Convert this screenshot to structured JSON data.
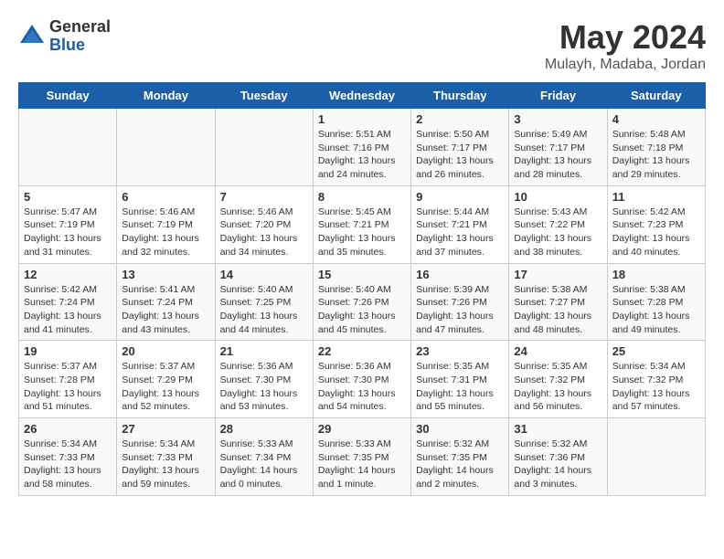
{
  "header": {
    "logo_general": "General",
    "logo_blue": "Blue",
    "title": "May 2024",
    "subtitle": "Mulayh, Madaba, Jordan"
  },
  "days_of_week": [
    "Sunday",
    "Monday",
    "Tuesday",
    "Wednesday",
    "Thursday",
    "Friday",
    "Saturday"
  ],
  "weeks": [
    [
      {
        "day": "",
        "info": ""
      },
      {
        "day": "",
        "info": ""
      },
      {
        "day": "",
        "info": ""
      },
      {
        "day": "1",
        "info": "Sunrise: 5:51 AM\nSunset: 7:16 PM\nDaylight: 13 hours\nand 24 minutes."
      },
      {
        "day": "2",
        "info": "Sunrise: 5:50 AM\nSunset: 7:17 PM\nDaylight: 13 hours\nand 26 minutes."
      },
      {
        "day": "3",
        "info": "Sunrise: 5:49 AM\nSunset: 7:17 PM\nDaylight: 13 hours\nand 28 minutes."
      },
      {
        "day": "4",
        "info": "Sunrise: 5:48 AM\nSunset: 7:18 PM\nDaylight: 13 hours\nand 29 minutes."
      }
    ],
    [
      {
        "day": "5",
        "info": "Sunrise: 5:47 AM\nSunset: 7:19 PM\nDaylight: 13 hours\nand 31 minutes."
      },
      {
        "day": "6",
        "info": "Sunrise: 5:46 AM\nSunset: 7:19 PM\nDaylight: 13 hours\nand 32 minutes."
      },
      {
        "day": "7",
        "info": "Sunrise: 5:46 AM\nSunset: 7:20 PM\nDaylight: 13 hours\nand 34 minutes."
      },
      {
        "day": "8",
        "info": "Sunrise: 5:45 AM\nSunset: 7:21 PM\nDaylight: 13 hours\nand 35 minutes."
      },
      {
        "day": "9",
        "info": "Sunrise: 5:44 AM\nSunset: 7:21 PM\nDaylight: 13 hours\nand 37 minutes."
      },
      {
        "day": "10",
        "info": "Sunrise: 5:43 AM\nSunset: 7:22 PM\nDaylight: 13 hours\nand 38 minutes."
      },
      {
        "day": "11",
        "info": "Sunrise: 5:42 AM\nSunset: 7:23 PM\nDaylight: 13 hours\nand 40 minutes."
      }
    ],
    [
      {
        "day": "12",
        "info": "Sunrise: 5:42 AM\nSunset: 7:24 PM\nDaylight: 13 hours\nand 41 minutes."
      },
      {
        "day": "13",
        "info": "Sunrise: 5:41 AM\nSunset: 7:24 PM\nDaylight: 13 hours\nand 43 minutes."
      },
      {
        "day": "14",
        "info": "Sunrise: 5:40 AM\nSunset: 7:25 PM\nDaylight: 13 hours\nand 44 minutes."
      },
      {
        "day": "15",
        "info": "Sunrise: 5:40 AM\nSunset: 7:26 PM\nDaylight: 13 hours\nand 45 minutes."
      },
      {
        "day": "16",
        "info": "Sunrise: 5:39 AM\nSunset: 7:26 PM\nDaylight: 13 hours\nand 47 minutes."
      },
      {
        "day": "17",
        "info": "Sunrise: 5:38 AM\nSunset: 7:27 PM\nDaylight: 13 hours\nand 48 minutes."
      },
      {
        "day": "18",
        "info": "Sunrise: 5:38 AM\nSunset: 7:28 PM\nDaylight: 13 hours\nand 49 minutes."
      }
    ],
    [
      {
        "day": "19",
        "info": "Sunrise: 5:37 AM\nSunset: 7:28 PM\nDaylight: 13 hours\nand 51 minutes."
      },
      {
        "day": "20",
        "info": "Sunrise: 5:37 AM\nSunset: 7:29 PM\nDaylight: 13 hours\nand 52 minutes."
      },
      {
        "day": "21",
        "info": "Sunrise: 5:36 AM\nSunset: 7:30 PM\nDaylight: 13 hours\nand 53 minutes."
      },
      {
        "day": "22",
        "info": "Sunrise: 5:36 AM\nSunset: 7:30 PM\nDaylight: 13 hours\nand 54 minutes."
      },
      {
        "day": "23",
        "info": "Sunrise: 5:35 AM\nSunset: 7:31 PM\nDaylight: 13 hours\nand 55 minutes."
      },
      {
        "day": "24",
        "info": "Sunrise: 5:35 AM\nSunset: 7:32 PM\nDaylight: 13 hours\nand 56 minutes."
      },
      {
        "day": "25",
        "info": "Sunrise: 5:34 AM\nSunset: 7:32 PM\nDaylight: 13 hours\nand 57 minutes."
      }
    ],
    [
      {
        "day": "26",
        "info": "Sunrise: 5:34 AM\nSunset: 7:33 PM\nDaylight: 13 hours\nand 58 minutes."
      },
      {
        "day": "27",
        "info": "Sunrise: 5:34 AM\nSunset: 7:33 PM\nDaylight: 13 hours\nand 59 minutes."
      },
      {
        "day": "28",
        "info": "Sunrise: 5:33 AM\nSunset: 7:34 PM\nDaylight: 14 hours\nand 0 minutes."
      },
      {
        "day": "29",
        "info": "Sunrise: 5:33 AM\nSunset: 7:35 PM\nDaylight: 14 hours\nand 1 minute."
      },
      {
        "day": "30",
        "info": "Sunrise: 5:32 AM\nSunset: 7:35 PM\nDaylight: 14 hours\nand 2 minutes."
      },
      {
        "day": "31",
        "info": "Sunrise: 5:32 AM\nSunset: 7:36 PM\nDaylight: 14 hours\nand 3 minutes."
      },
      {
        "day": "",
        "info": ""
      }
    ]
  ]
}
